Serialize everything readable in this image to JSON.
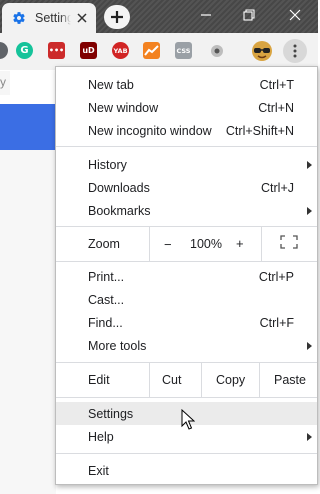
{
  "browser": {
    "tab_title": "Settings",
    "omnibox_fragment": "y"
  },
  "extensions": [
    {
      "name": "grammarly-extension",
      "text": "G",
      "color": "#15c39a"
    },
    {
      "name": "lastpass-extension",
      "text": "•••",
      "color": "#cc2b2b"
    },
    {
      "name": "ublock-extension",
      "text": "uD",
      "color": "#800000"
    },
    {
      "name": "yab-extension",
      "text": "YAB",
      "color": "#d12424"
    },
    {
      "name": "analytics-extension",
      "text": "",
      "color": "#f38220"
    },
    {
      "name": "css-extension",
      "text": "CSS",
      "color": "#9aa0a6"
    },
    {
      "name": "record-extension",
      "text": "",
      "color": "#9e9e9e"
    }
  ],
  "menu": {
    "new_tab": "New tab",
    "new_tab_sc": "Ctrl+T",
    "new_window": "New window",
    "new_window_sc": "Ctrl+N",
    "new_incognito": "New incognito window",
    "new_incognito_sc": "Ctrl+Shift+N",
    "history": "History",
    "downloads": "Downloads",
    "downloads_sc": "Ctrl+J",
    "bookmarks": "Bookmarks",
    "zoom": "Zoom",
    "zoom_minus": "−",
    "zoom_value": "100%",
    "zoom_plus": "+",
    "print": "Print...",
    "print_sc": "Ctrl+P",
    "cast": "Cast...",
    "find": "Find...",
    "find_sc": "Ctrl+F",
    "more_tools": "More tools",
    "edit": "Edit",
    "cut": "Cut",
    "copy": "Copy",
    "paste": "Paste",
    "settings": "Settings",
    "help": "Help",
    "exit": "Exit"
  }
}
